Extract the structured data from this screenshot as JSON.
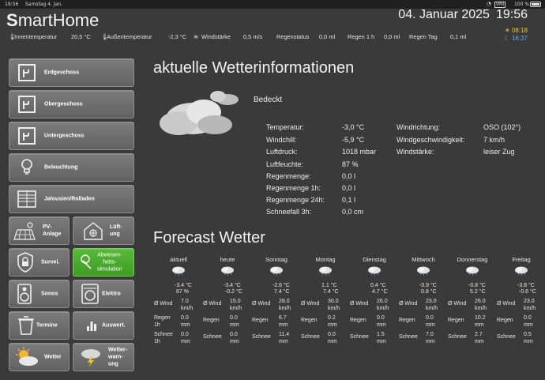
{
  "statusbar": {
    "time": "19:56",
    "date": "Samstag 4. Jan.",
    "vpn": "VPN",
    "battery": "100 %"
  },
  "header": {
    "logo_bold": "S",
    "logo_rest": "martHome",
    "date": "04. Januar 2025",
    "time": "19:56",
    "sunrise": "08:18",
    "sunset": "16:37"
  },
  "sensors": {
    "inside_label": "Innentemperatur",
    "inside_value": "20,5 °C",
    "outside_label": "Außentemperatur",
    "outside_value": "-2,3 °C",
    "wind_label": "Windstärke",
    "wind_value": "0,5 m/s",
    "rain_status_label": "Regenstatus",
    "rain_status_value": "0,0 ml",
    "rain_hour_label": "Regen 1 h",
    "rain_hour_value": "0,0 ml",
    "rain_day_label": "Regen Tag",
    "rain_day_value": "0,1 ml"
  },
  "nav": {
    "erdgeschoss": "Erdgeschoss",
    "obergeschoss": "Obergeschoss",
    "untergeschoss": "Untergeschoss",
    "beleuchtung": "Beleuchtung",
    "jalousien": "Jalousien/Rolladen",
    "pv": "PV-\nAnlage",
    "lueftung": "Lüft-\nung",
    "surveil": "Survei.",
    "abwesenheit": "Abwesen-\nheits-\nsimulation",
    "sonos": "Sonos",
    "elektro": "Elektro",
    "termine": "Termine",
    "auswert": "Auswert.",
    "wetter": "Wetter",
    "warnung": "Wetter-\nwarn-\nung"
  },
  "current": {
    "title": "aktuelle Wetterinformationen",
    "condition": "Bedeckt",
    "rows": [
      {
        "label": "Temperatur:",
        "value": "-3,0 °C"
      },
      {
        "label": "Windchill:",
        "value": "-5,9 °C"
      },
      {
        "label": "Luftdruck:",
        "value": "1018 mbar"
      },
      {
        "label": "Luftfeuchte:",
        "value": "87 %"
      },
      {
        "label": "Regenmenge:",
        "value": "0,0 l"
      },
      {
        "label": "Regenmenge 1h:",
        "value": "0,0 l"
      },
      {
        "label": "Regenmenge 24h:",
        "value": "0,1 l"
      },
      {
        "label": "Schneefall 3h:",
        "value": "0,0 cm"
      }
    ],
    "wind": [
      {
        "label": "Windrichtung:",
        "value": "OSO (102°)"
      },
      {
        "label": "Windgeschwindigkeit:",
        "value": "7 km/h"
      },
      {
        "label": "Windstärke:",
        "value": "leiser Zug"
      }
    ]
  },
  "forecast": {
    "title": "Forecast Wetter",
    "wind_label": "Ø Wind",
    "rain_label": "Regen",
    "rain_label2": "1h",
    "snow_label": "Schnee",
    "snow_label2": "1h",
    "days": [
      {
        "day": "aktuell",
        "t1": "-3.4 °C",
        "t2": "87 %",
        "wind": "7.0",
        "wind_unit": "km/h",
        "rain": "0.0",
        "rain_unit": "mm",
        "snow": "0.0",
        "snow_unit": "mm"
      },
      {
        "day": "heute",
        "t1": "-3.4 °C",
        "t2": "-0.2 °C",
        "wind": "15.0",
        "wind_unit": "km/h",
        "rain": "0.0",
        "rain_unit": "mm",
        "snow": "0.0",
        "snow_unit": "mm"
      },
      {
        "day": "Sonntag",
        "t1": "-2.6 °C",
        "t2": "7.4 °C",
        "wind": "28.0",
        "wind_unit": "km/h",
        "rain": "6.7",
        "rain_unit": "mm",
        "snow": "11.4",
        "snow_unit": "mm"
      },
      {
        "day": "Montag",
        "t1": "1.1 °C",
        "t2": "7.4 °C",
        "wind": "30.0",
        "wind_unit": "km/h",
        "rain": "0.2",
        "rain_unit": "mm",
        "snow": "0.0",
        "snow_unit": "mm"
      },
      {
        "day": "Dienstag",
        "t1": "0.4 °C",
        "t2": "4.7 °C",
        "wind": "26.0",
        "wind_unit": "km/h",
        "rain": "0.0",
        "rain_unit": "mm",
        "snow": "1.5",
        "snow_unit": "mm"
      },
      {
        "day": "Mittwoch",
        "t1": "-0.9 °C",
        "t2": "0.8 °C",
        "wind": "23.0",
        "wind_unit": "km/h",
        "rain": "0.0",
        "rain_unit": "mm",
        "snow": "7.0",
        "snow_unit": "mm"
      },
      {
        "day": "Donnerstag",
        "t1": "-0.8 °C",
        "t2": "5.2 °C",
        "wind": "26.0",
        "wind_unit": "km/h",
        "rain": "10.2",
        "rain_unit": "mm",
        "snow": "2.7",
        "snow_unit": "mm"
      },
      {
        "day": "Freitag",
        "t1": "-3.8 °C",
        "t2": "-0.6 °C",
        "wind": "23.0",
        "wind_unit": "km/h",
        "rain": "0.0",
        "rain_unit": "mm",
        "snow": "0.5",
        "snow_unit": "mm"
      }
    ]
  },
  "colors": {
    "background": "#3a3a3a",
    "button": "#6e6e6e",
    "active_button": "#4caa2e",
    "sunrise": "#f0c23a",
    "sunset": "#6ea7ff"
  }
}
